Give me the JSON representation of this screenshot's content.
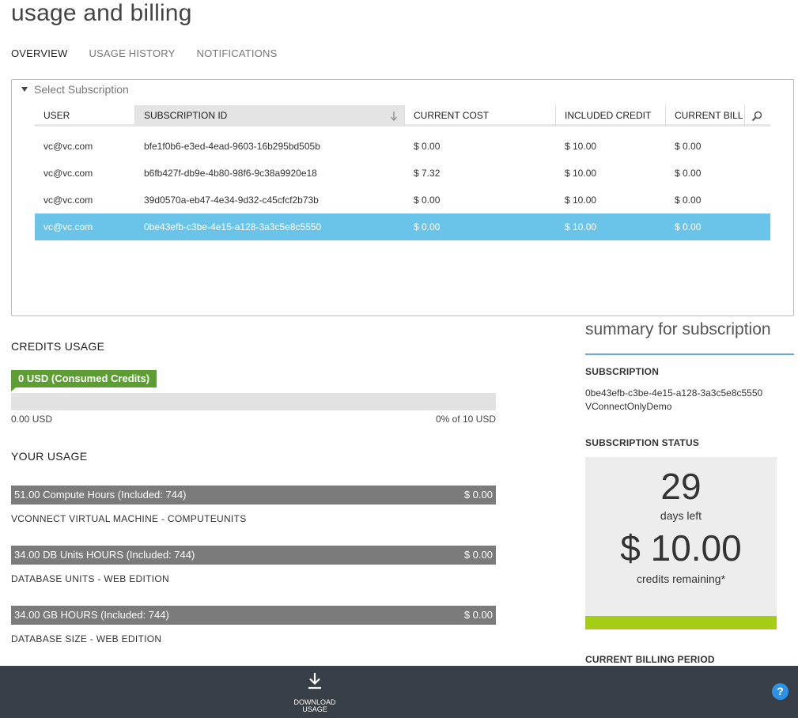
{
  "page": {
    "title": "usage and billing"
  },
  "tabs": [
    {
      "label": "OVERVIEW",
      "active": true
    },
    {
      "label": "USAGE HISTORY",
      "active": false
    },
    {
      "label": "NOTIFICATIONS",
      "active": false
    }
  ],
  "subscription_panel": {
    "header": "Select Subscription",
    "columns": [
      "USER",
      "SUBSCRIPTION ID",
      "CURRENT COST",
      "INCLUDED CREDIT",
      "CURRENT BILL"
    ],
    "sorted_column": "SUBSCRIPTION ID",
    "rows": [
      {
        "user": "vc@vc.com",
        "subscription_id": "bfe1f0b6-e3ed-4ead-9603-16b295bd505b",
        "current_cost": "$ 0.00",
        "included_credit": "$ 10.00",
        "current_bill": "$ 0.00",
        "selected": false
      },
      {
        "user": "vc@vc.com",
        "subscription_id": "b6fb427f-db9e-4b80-98f6-9c38a9920e18",
        "current_cost": "$ 7.32",
        "included_credit": "$ 10.00",
        "current_bill": "$ 0.00",
        "selected": false
      },
      {
        "user": "vc@vc.com",
        "subscription_id": "39d0570a-eb47-4e34-9d32-c45cfcf2b73b",
        "current_cost": "$ 0.00",
        "included_credit": "$ 10.00",
        "current_bill": "$ 0.00",
        "selected": false
      },
      {
        "user": "vc@vc.com",
        "subscription_id": "0be43efb-c3be-4e15-a128-3a3c5e8c5550",
        "current_cost": "$ 0.00",
        "included_credit": "$ 10.00",
        "current_bill": "$ 0.00",
        "selected": true
      }
    ]
  },
  "credits_usage": {
    "title": "CREDITS USAGE",
    "badge": "0 USD (Consumed Credits)",
    "consumed_fraction": 0,
    "left_label": "0.00 USD",
    "right_label": "0% of 10 USD"
  },
  "your_usage": {
    "title": "YOUR USAGE",
    "items": [
      {
        "bar_text": "51.00 Compute Hours (Included: 744)",
        "amount": "$ 0.00",
        "name": "VCONNECT VIRTUAL MACHINE - COMPUTEUNITS"
      },
      {
        "bar_text": "34.00 DB Units HOURS (Included: 744)",
        "amount": "$ 0.00",
        "name": "DATABASE UNITS - WEB EDITION"
      },
      {
        "bar_text": "34.00 GB HOURS (Included: 744)",
        "amount": "$ 0.00",
        "name": "DATABASE SIZE - WEB EDITION"
      }
    ]
  },
  "summary": {
    "title": "summary for subscription",
    "subscription_label": "SUBSCRIPTION",
    "subscription_id": "0be43efb-c3be-4e15-a128-3a3c5e8c5550",
    "subscription_name": "VConnectOnlyDemo",
    "status_label": "SUBSCRIPTION STATUS",
    "days_left_value": "29",
    "days_left_label": "days left",
    "credits_value": "$ 10.00",
    "credits_label": "credits remaining*",
    "billing_period_label": "CURRENT BILLING PERIOD"
  },
  "bottom_bar": {
    "download_label_line1": "DOWNLOAD",
    "download_label_line2": "USAGE",
    "help_glyph": "?"
  },
  "icons": {
    "sort": "arrow-down-icon",
    "search": "search-icon",
    "download": "download-icon",
    "help": "help-icon"
  },
  "colors": {
    "selected_row": "#6ac4ea",
    "credit_green": "#5c9e32",
    "usage_bar_gray": "#7b7b7b",
    "status_lime": "#a6cd16",
    "bottom_bar": "#393f46",
    "help_blue": "#2e93e5"
  }
}
